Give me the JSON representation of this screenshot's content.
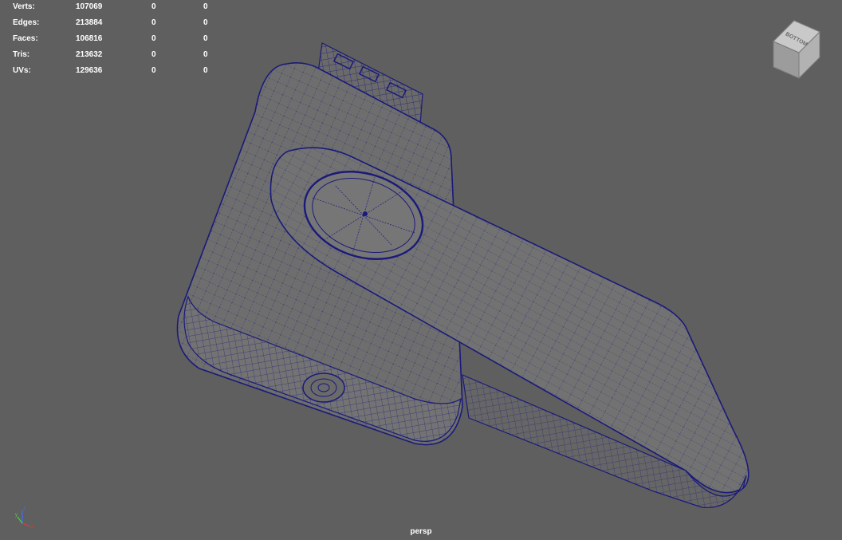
{
  "hud": {
    "rows": [
      {
        "label": "Verts:",
        "total": "107069",
        "selected": "0",
        "component": "0"
      },
      {
        "label": "Edges:",
        "total": "213884",
        "selected": "0",
        "component": "0"
      },
      {
        "label": "Faces:",
        "total": "106816",
        "selected": "0",
        "component": "0"
      },
      {
        "label": "Tris:",
        "total": "213632",
        "selected": "0",
        "component": "0"
      },
      {
        "label": "UVs:",
        "total": "129636",
        "selected": "0",
        "component": "0"
      }
    ]
  },
  "view_cube": {
    "face_label": "BOTTOM"
  },
  "camera": {
    "name": "persp"
  },
  "colors": {
    "viewport_bg": "#5f5f5f",
    "wire": "#1a1a7a",
    "wire_light": "#2a2aa0",
    "surface": "#6e6e6e",
    "surface_light": "#7c7c7c",
    "hud_text": "#ffffff",
    "axis_x": "#e23a3a",
    "axis_y": "#4fd04f",
    "axis_z": "#4a6ef0"
  }
}
